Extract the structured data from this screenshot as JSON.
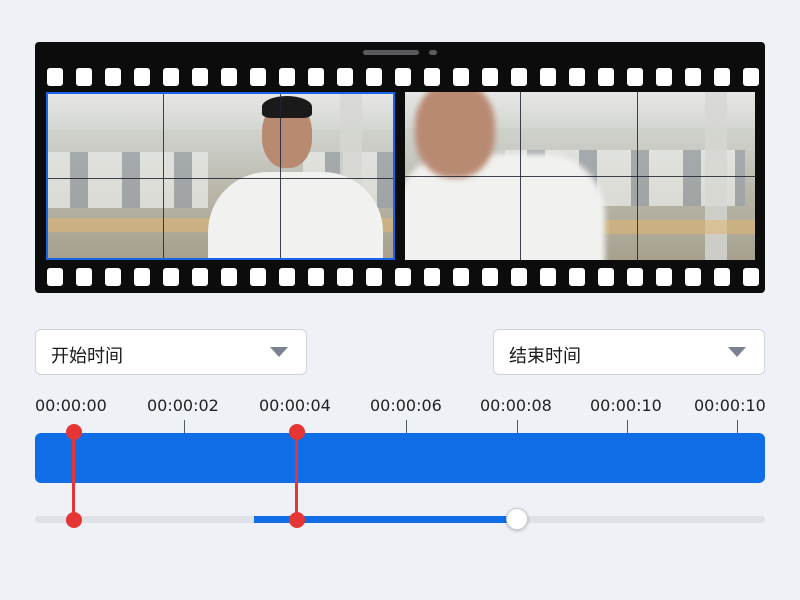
{
  "filmstrip": {
    "frames": [
      {
        "name": "frame-1",
        "selected": true
      },
      {
        "name": "frame-2",
        "selected": false
      }
    ]
  },
  "start_time": {
    "label": "开始时间",
    "icon": "chevron-down-icon"
  },
  "end_time": {
    "label": "结束时间",
    "icon": "chevron-down-icon"
  },
  "ruler": {
    "ticks": [
      "00:00:00",
      "00:00:02",
      "00:00:04",
      "00:00:06",
      "00:00:08",
      "00:00:10",
      "00:00:10"
    ]
  },
  "colors": {
    "accent": "#0f6de6",
    "marker": "#e53535",
    "background": "#eef1f6"
  },
  "slider": {
    "range_start_fraction": 0.3,
    "value_fraction": 0.66
  }
}
